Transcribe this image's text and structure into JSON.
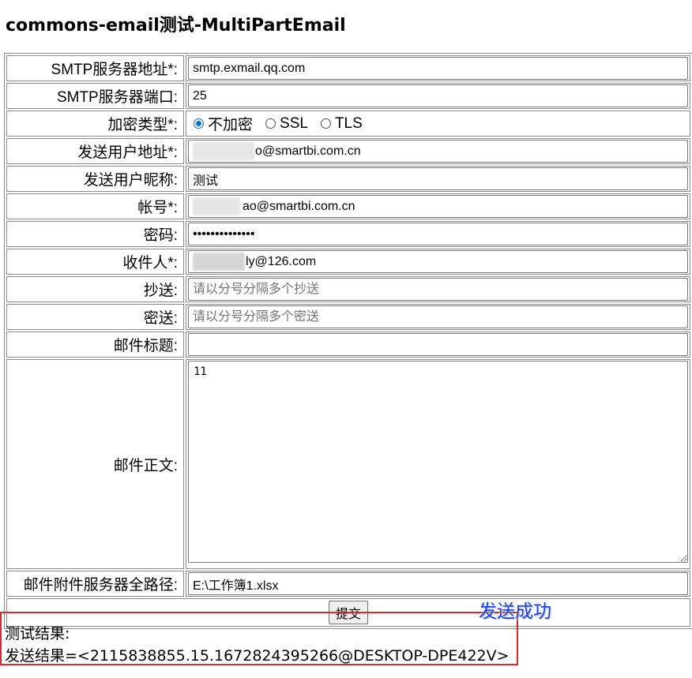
{
  "page": {
    "title": "commons-email测试-MultiPartEmail"
  },
  "form": {
    "smtp_host": {
      "label": "SMTP服务器地址*:",
      "value": "smtp.exmail.qq.com"
    },
    "smtp_port": {
      "label": "SMTP服务器端口:",
      "value": "25"
    },
    "encryption": {
      "label": "加密类型*:",
      "options": [
        {
          "label": "不加密",
          "checked": true
        },
        {
          "label": "SSL",
          "checked": false
        },
        {
          "label": "TLS",
          "checked": false
        }
      ]
    },
    "sender_address": {
      "label": "发送用户地址*:",
      "value": "o@smartbi.com.cn"
    },
    "sender_nickname": {
      "label": "发送用户昵称:",
      "value": "测试"
    },
    "account": {
      "label": "帐号*:",
      "value": "ao@smartbi.com.cn"
    },
    "password": {
      "label": "密码:",
      "value": "••••••••••••••"
    },
    "recipient": {
      "label": "收件人*:",
      "value": "ly@126.com"
    },
    "cc": {
      "label": "抄送:",
      "placeholder": "请以分号分隔多个抄送"
    },
    "bcc": {
      "label": "密送:",
      "placeholder": "请以分号分隔多个密送"
    },
    "subject": {
      "label": "邮件标题:",
      "value": ""
    },
    "body": {
      "label": "邮件正文:",
      "value": "11"
    },
    "attachment": {
      "label": "邮件附件服务器全路径:",
      "value": "E:\\工作簿1.xlsx"
    },
    "submit_label": "提交"
  },
  "result": {
    "heading": "测试结果:",
    "line": "发送结果=<2115838855.15.1672824395266@DESKTOP-DPE422V>"
  },
  "annotation": {
    "text": "发送成功",
    "color": "#1a3df0",
    "box_color": "#d9292f"
  },
  "colors": {
    "radio_accent": "#0a6ed1"
  }
}
